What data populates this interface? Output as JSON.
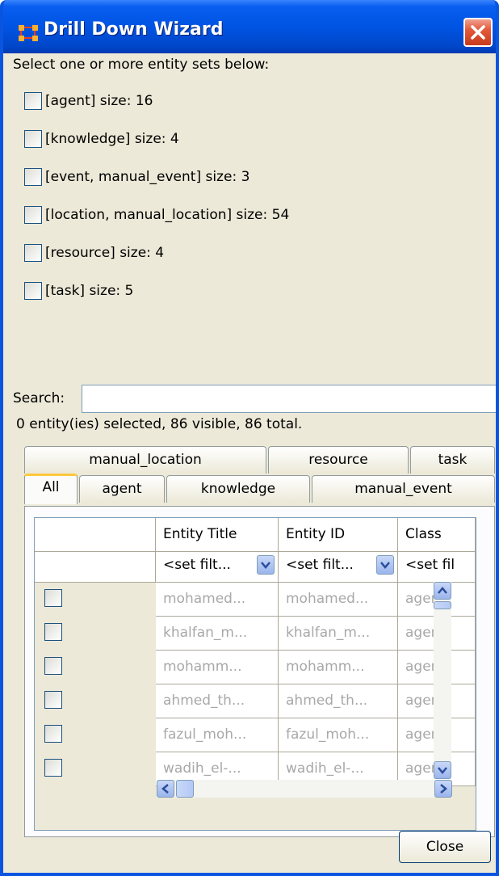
{
  "window": {
    "title": "Drill Down Wizard"
  },
  "prompt": "Select one or more entity sets below:",
  "entity_sets": [
    {
      "label": "[agent] size: 16",
      "checked": false
    },
    {
      "label": "[knowledge] size: 4",
      "checked": false
    },
    {
      "label": "[event, manual_event] size: 3",
      "checked": false
    },
    {
      "label": "[location, manual_location] size: 54",
      "checked": false
    },
    {
      "label": "[resource] size: 4",
      "checked": false
    },
    {
      "label": "[task] size: 5",
      "checked": false
    }
  ],
  "search": {
    "label": "Search:",
    "value": ""
  },
  "status": "0 entity(ies) selected, 86 visible, 86 total.",
  "tabs_top": [
    "manual_location",
    "resource",
    "task"
  ],
  "tabs_bottom": [
    "All",
    "agent",
    "knowledge",
    "manual_event"
  ],
  "active_tab": "All",
  "table": {
    "columns": [
      "Entity Title",
      "Entity ID",
      "Class"
    ],
    "filters": [
      "<set filt...",
      "<set filt...",
      "<set fil"
    ],
    "rows": [
      [
        "mohamed...",
        "mohamed...",
        "agent"
      ],
      [
        "khalfan_m...",
        "khalfan_m...",
        "agent"
      ],
      [
        "mohamm...",
        "mohamm...",
        "agent"
      ],
      [
        "ahmed_th...",
        "ahmed_th...",
        "agent"
      ],
      [
        "fazul_moh...",
        "fazul_moh...",
        "agent"
      ],
      [
        "wadih_el-...",
        "wadih_el-...",
        "agent"
      ]
    ]
  },
  "buttons": {
    "close": "Close"
  },
  "colors": {
    "titlebar": "#0054e3",
    "dialog_bg": "#ece9d8",
    "tab_highlight": "#ffc83c"
  }
}
